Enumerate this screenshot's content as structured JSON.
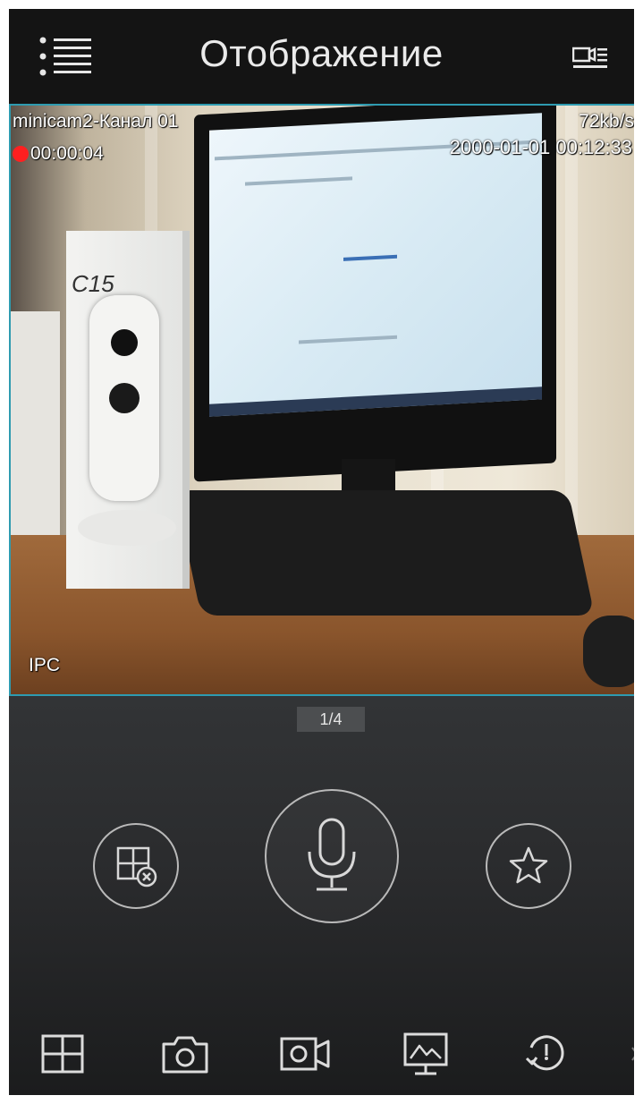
{
  "header": {
    "title": "Отображение",
    "menu_icon": "menu-list-icon",
    "channels_icon": "camera-list-icon"
  },
  "video": {
    "camera_name": "minicam2-Канал 01",
    "record_time": "00:00:04",
    "bitrate": "72kb/s",
    "datetime": "2000-01-01 00:12:33",
    "device_type": "IPC",
    "box_label": "C15"
  },
  "controls": {
    "page_indicator": "1/4",
    "close_window_icon": "close-window-icon",
    "talk_icon": "microphone-icon",
    "favorite_icon": "star-icon"
  },
  "tabbar": {
    "items": [
      {
        "icon": "split-screen-icon"
      },
      {
        "icon": "camera-snapshot-icon"
      },
      {
        "icon": "video-record-icon"
      },
      {
        "icon": "monitor-icon"
      },
      {
        "icon": "playback-icon"
      }
    ]
  },
  "colors": {
    "header_bg": "#141414",
    "video_border": "#2e9bb0",
    "rec_dot": "#ff2020",
    "icon_stroke": "#d8d8d8"
  }
}
